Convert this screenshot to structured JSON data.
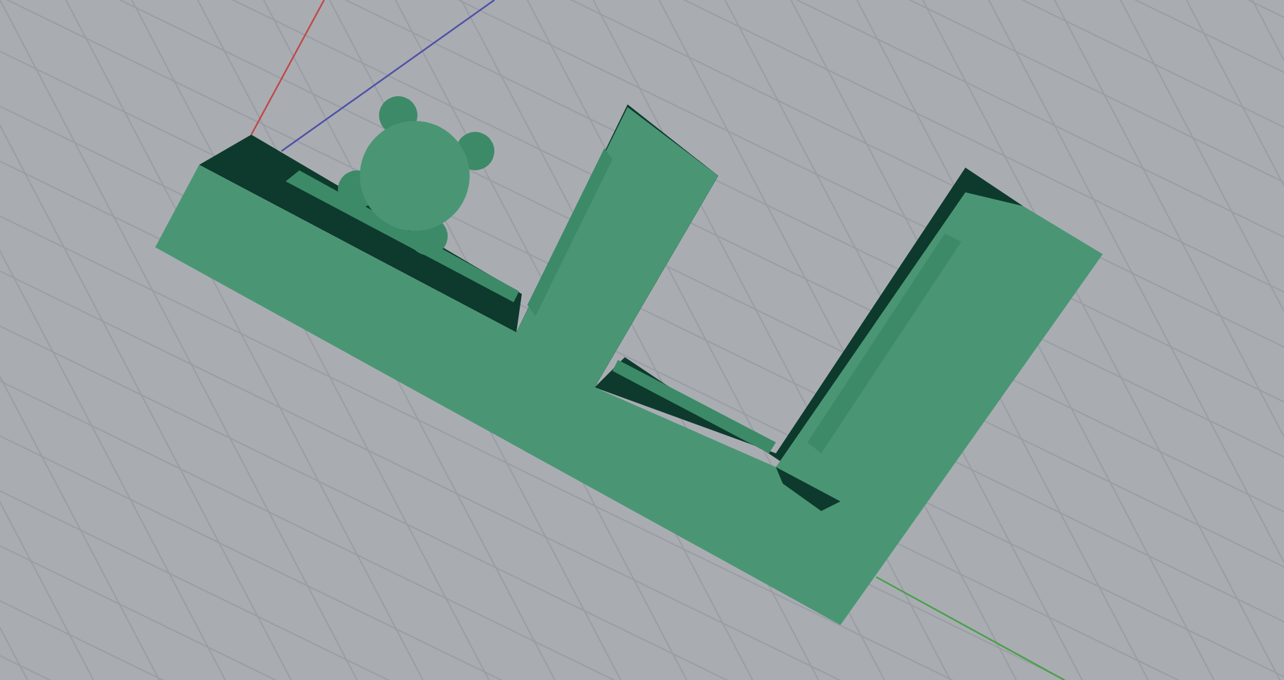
{
  "viewport": {
    "axes": [
      {
        "kind": "x",
        "color": "#c04848"
      },
      {
        "kind": "y",
        "color": "#5050a8"
      },
      {
        "kind": "z",
        "color": "#48a048"
      }
    ]
  }
}
